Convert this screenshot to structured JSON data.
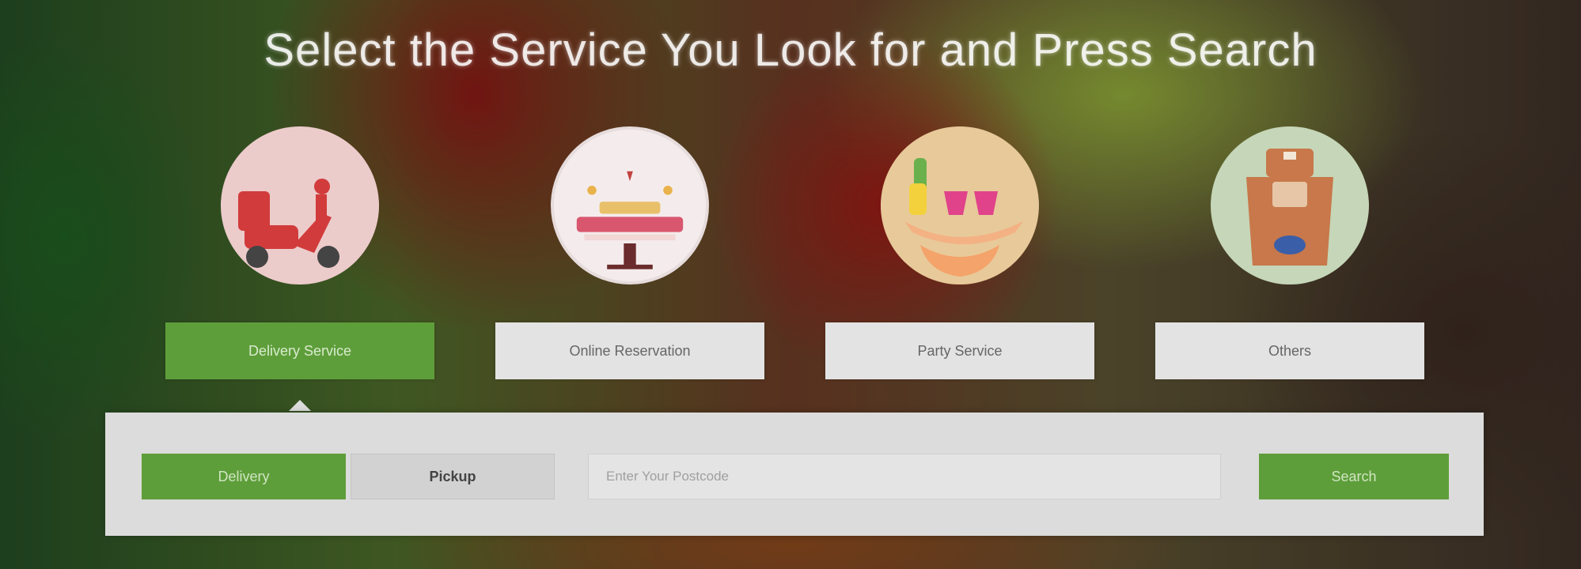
{
  "headline": "Select the Service You Look for and Press Search",
  "services": [
    {
      "label": "Delivery Service",
      "icon": "scooter-icon",
      "active": true
    },
    {
      "label": "Online Reservation",
      "icon": "reservation-table-icon",
      "active": false
    },
    {
      "label": "Party Service",
      "icon": "party-platter-icon",
      "active": false
    },
    {
      "label": "Others",
      "icon": "chef-apron-icon",
      "active": false
    }
  ],
  "search": {
    "delivery_label": "Delivery",
    "pickup_label": "Pickup",
    "postcode_placeholder": "Enter Your Postcode",
    "search_label": "Search"
  },
  "colors": {
    "accent": "#5e9e3a",
    "panel": "#dcdcdc",
    "button_inactive": "#e3e3e3"
  }
}
